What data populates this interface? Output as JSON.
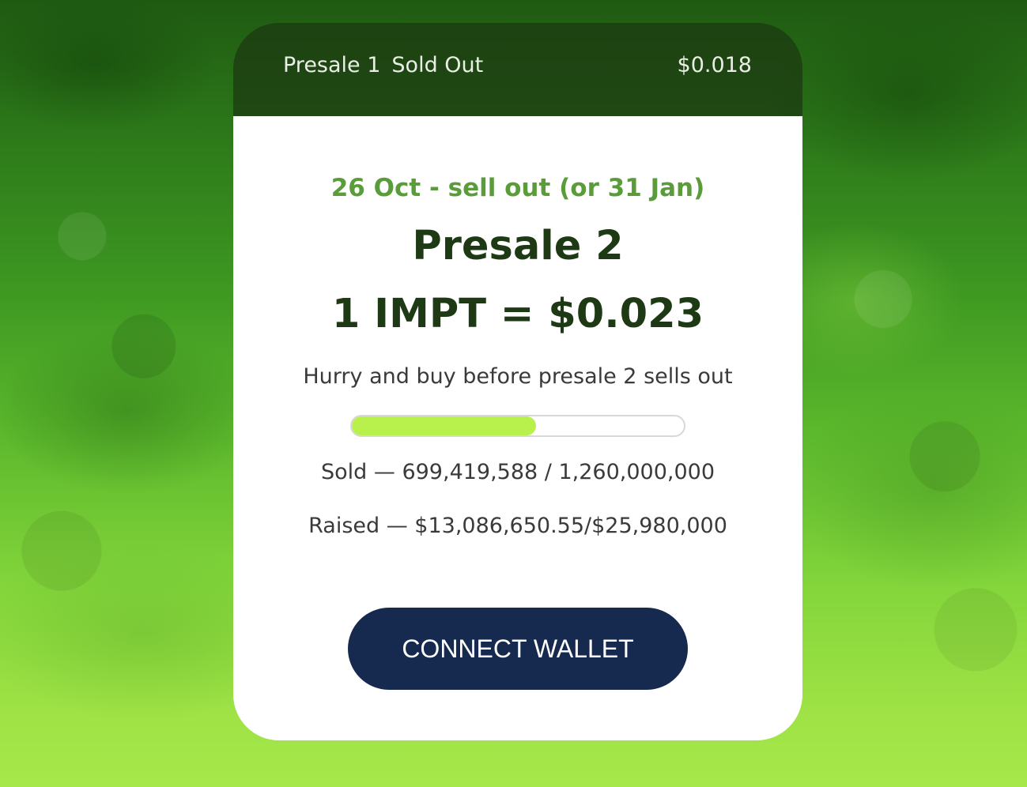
{
  "header": {
    "stage_label": "Presale 1",
    "stage_status": "Sold Out",
    "stage_price": "$0.018"
  },
  "card": {
    "dates": "26 Oct - sell out (or 31 Jan)",
    "title": "Presale 2",
    "price": "1 IMPT = $0.023",
    "message": "Hurry and buy before presale 2 sells out",
    "progress_fraction": 0.555,
    "sold": "Sold — 699,419,588 / 1,260,000,000",
    "raised": "Raised — $13,086,650.55/$25,980,000",
    "button_label": "CONNECT WALLET"
  },
  "colors": {
    "accent_green": "#5a9b3a",
    "heading": "#1e3a14",
    "progress_fill": "#b8f04c",
    "button_bg": "#152a4e"
  }
}
